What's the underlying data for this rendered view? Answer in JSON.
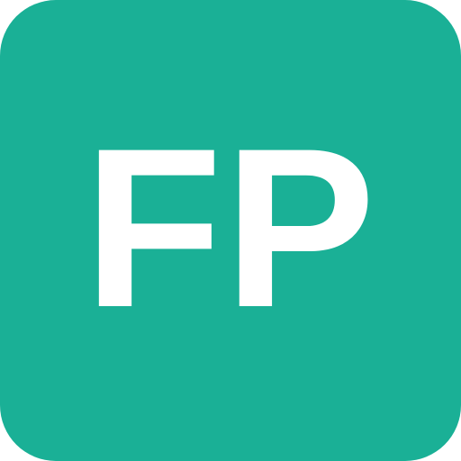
{
  "icon": {
    "monogram": "FP",
    "background_color": "#1AB096",
    "text_color": "#FFFFFF"
  }
}
